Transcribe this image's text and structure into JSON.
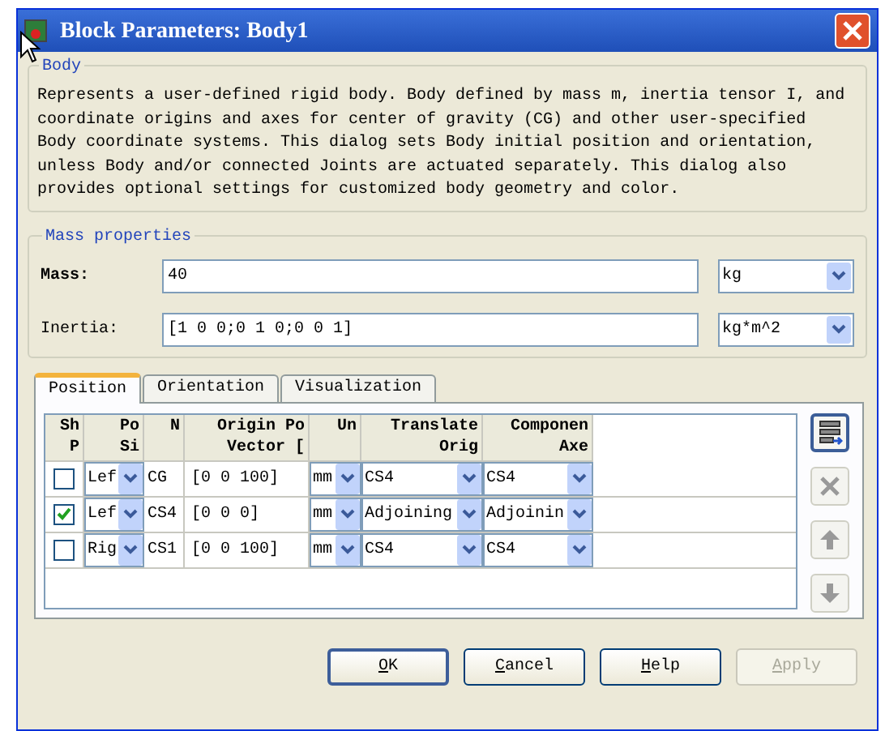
{
  "window": {
    "title": "Block Parameters: Body1"
  },
  "body_group": {
    "title": "Body",
    "description": "Represents a user-defined rigid body. Body defined by mass m, inertia tensor I, and coordinate origins and axes for center of gravity (CG) and other user-specified Body coordinate systems. This dialog sets Body initial position and orientation, unless Body and/or connected Joints are actuated separately. This dialog also provides optional settings for customized body geometry and color."
  },
  "mass_group": {
    "title": "Mass properties",
    "fields": [
      {
        "label": "Mass:",
        "value": "40",
        "unit": "kg"
      },
      {
        "label": "Inertia:",
        "value": "[1 0 0;0 1 0;0 0 1]",
        "unit": "kg*m^2"
      }
    ]
  },
  "tabs": [
    {
      "label": "Position",
      "selected": true
    },
    {
      "label": "Orientation",
      "selected": false
    },
    {
      "label": "Visualization",
      "selected": false
    }
  ],
  "table": {
    "columns": [
      [
        "Sh",
        "P"
      ],
      [
        "Po",
        "Si"
      ],
      [
        "N"
      ],
      [
        "Origin Po",
        "Vector ["
      ],
      [
        "Un"
      ],
      [
        "Translate",
        "Orig"
      ],
      [
        "Componen",
        "Axe"
      ]
    ],
    "rows": [
      {
        "checked": false,
        "side": "Lef",
        "name": "CG",
        "vector": "[0 0 100]",
        "units": "mm",
        "translate": "CS4",
        "axes": "CS4"
      },
      {
        "checked": true,
        "side": "Lef",
        "name": "CS4",
        "vector": "[0 0 0]",
        "units": "mm",
        "translate": "Adjoining",
        "axes": "Adjoinin"
      },
      {
        "checked": false,
        "side": "Rig",
        "name": "CS1",
        "vector": "[0 0 100]",
        "units": "mm",
        "translate": "CS4",
        "axes": "CS4"
      }
    ]
  },
  "side_buttons": [
    {
      "kind": "add",
      "disabled": false
    },
    {
      "kind": "delete",
      "disabled": true
    },
    {
      "kind": "up",
      "disabled": true
    },
    {
      "kind": "down",
      "disabled": true
    }
  ],
  "buttons": [
    {
      "label": "OK",
      "disabled": false,
      "default": true
    },
    {
      "label": "Cancel",
      "disabled": false,
      "default": false
    },
    {
      "label": "Help",
      "disabled": false,
      "default": false
    },
    {
      "label": "Apply",
      "disabled": true,
      "default": false
    }
  ]
}
